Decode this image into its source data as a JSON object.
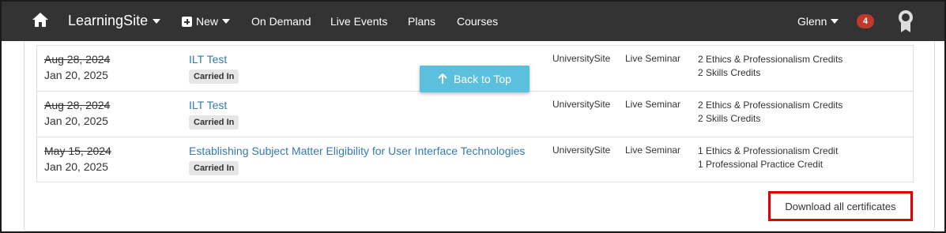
{
  "nav": {
    "brand": "LearningSite",
    "new_label": "New",
    "links": [
      "On Demand",
      "Live Events",
      "Plans",
      "Courses"
    ],
    "user": "Glenn",
    "notifications": "4"
  },
  "back_to_top": "Back to Top",
  "rows": [
    {
      "old_date": "Aug 28, 2024",
      "date": "Jan 20, 2025",
      "title": "ILT Test",
      "tag": "Carried In",
      "site": "UniversitySite",
      "type": "Live Seminar",
      "credits": [
        "2 Ethics & Professionalism Credits",
        "2 Skills Credits"
      ]
    },
    {
      "old_date": "Aug 28, 2024",
      "date": "Jan 20, 2025",
      "title": "ILT Test",
      "tag": "Carried In",
      "site": "UniversitySite",
      "type": "Live Seminar",
      "credits": [
        "2 Ethics & Professionalism Credits",
        "2 Skills Credits"
      ]
    },
    {
      "old_date": "May 15, 2024",
      "date": "Jan 20, 2025",
      "title": "Establishing Subject Matter Eligibility for User Interface Technologies",
      "tag": "Carried In",
      "site": "UniversitySite",
      "type": "Live Seminar",
      "credits": [
        "1 Ethics & Professionalism Credit",
        "1 Professional Practice Credit"
      ]
    }
  ],
  "download_label": "Download all certificates",
  "colors": {
    "navbar": "#333333",
    "link": "#337ab7",
    "accent": "#5bc0de",
    "badge": "#c0392b",
    "highlight": "#e00000"
  }
}
